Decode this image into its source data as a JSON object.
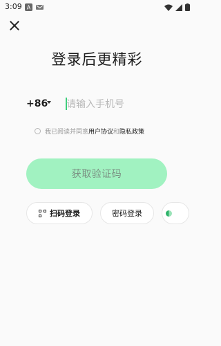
{
  "status_bar": {
    "time": "3:09"
  },
  "header": {
    "title": "登录后更精彩"
  },
  "phone": {
    "country_code": "+86",
    "placeholder": "请输入手机号"
  },
  "agreement": {
    "prefix": "我已阅读并同意 ",
    "user_agreement": "用户协议",
    "and": "和",
    "privacy_policy": "隐私政策"
  },
  "buttons": {
    "get_code": "获取验证码",
    "scan_login": "扫码登录",
    "password_login": "密码登录"
  },
  "colors": {
    "accent": "#a1f2c1",
    "cursor": "#3ccf7b"
  }
}
